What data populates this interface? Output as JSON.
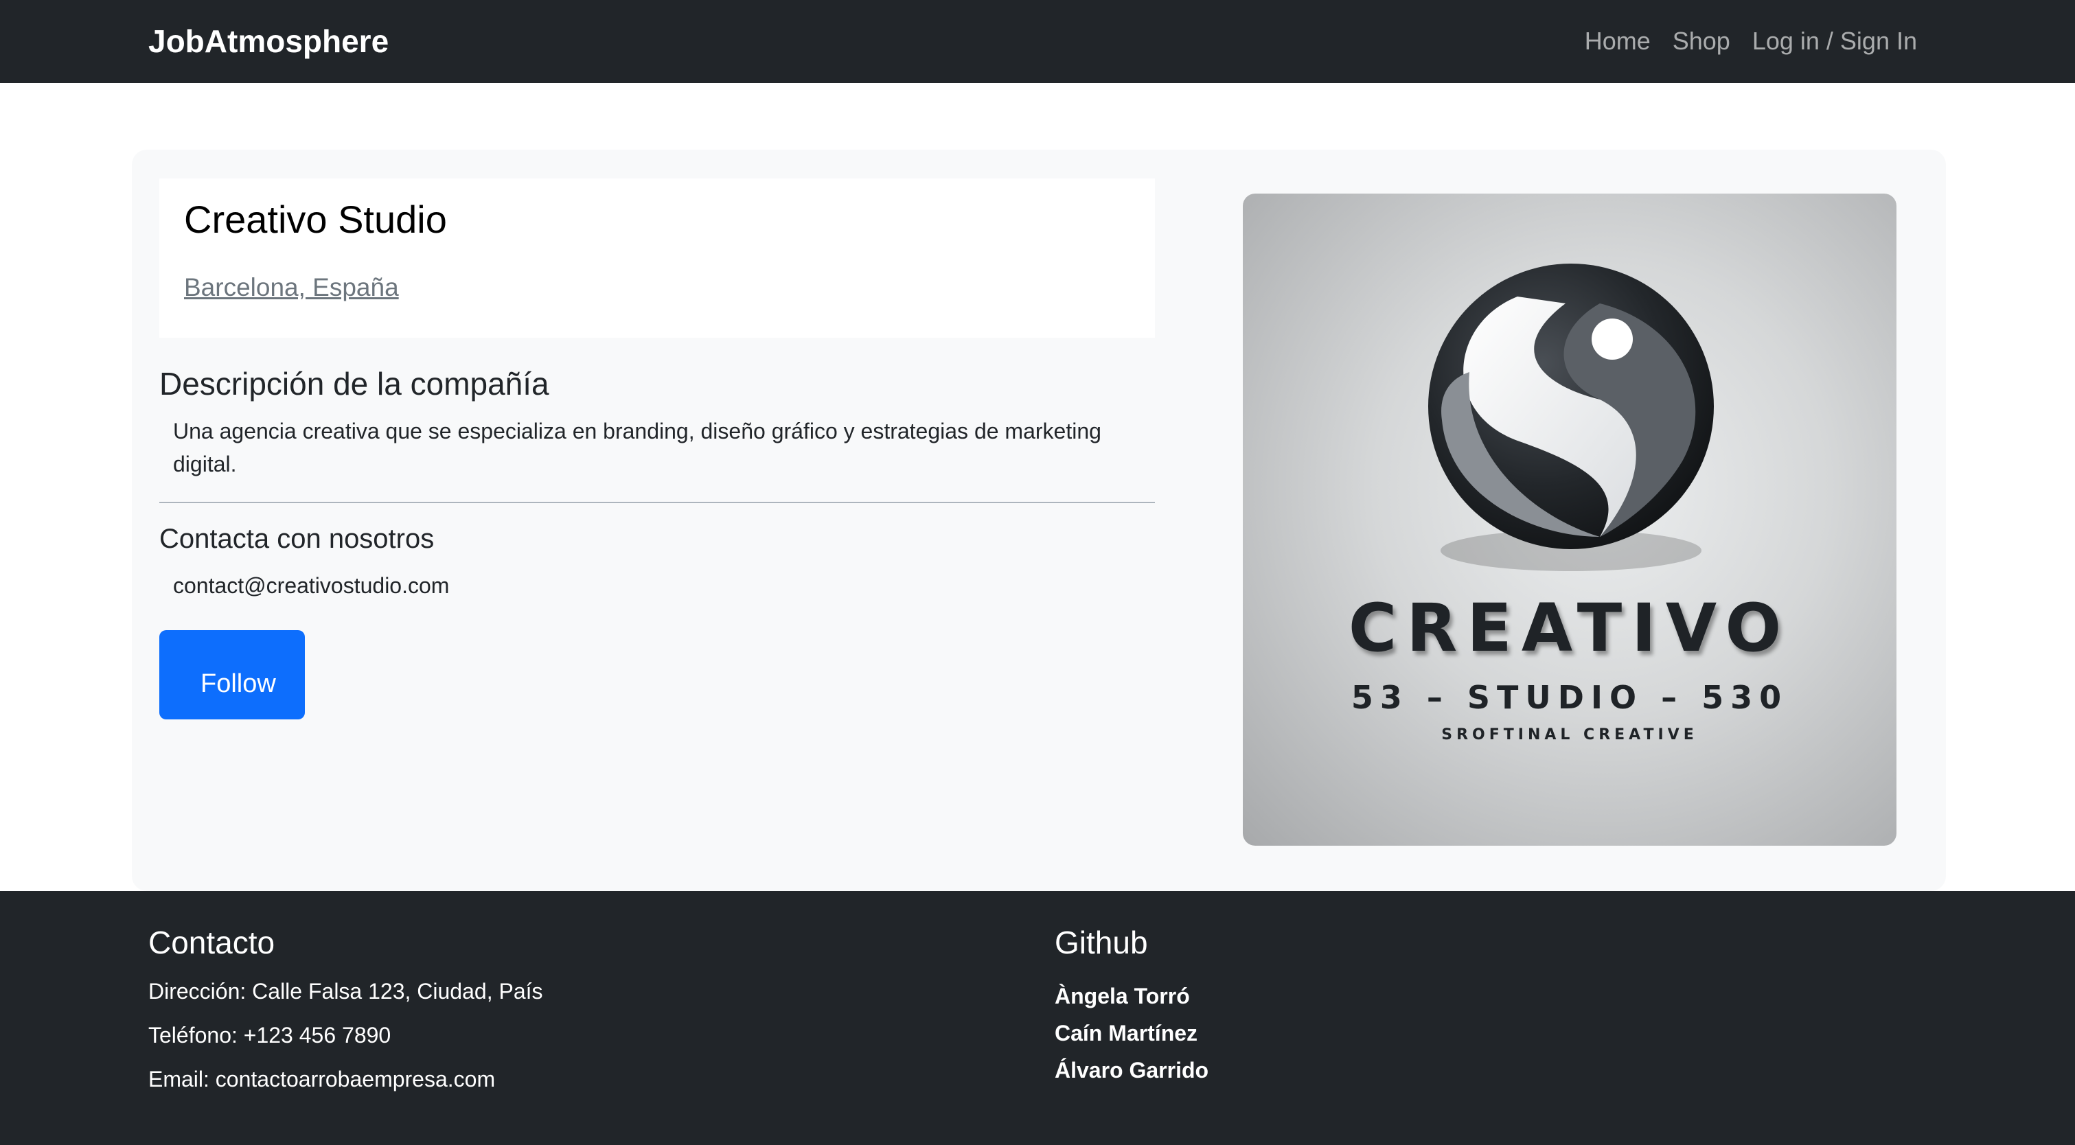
{
  "navbar": {
    "brand": "JobAtmosphere",
    "links": [
      "Home",
      "Shop",
      "Log in / Sign In"
    ]
  },
  "company": {
    "name": "Creativo Studio",
    "location": "Barcelona, España",
    "description_heading": "Descripción de la compañía",
    "description": "Una agencia creativa que se especializa en branding, diseño gráfico y estrategias de marketing digital.",
    "contact_heading": "Contacta con nosotros",
    "email": "contact@creativostudio.com",
    "follow_label": "Follow",
    "accent_color": "#0d6efd",
    "logo": {
      "icon": "swirl-logo-icon",
      "word_main": "CREATIVO",
      "word_sub": "53 – STUDIO – 530",
      "tagline": "SROFTINAL CREATIVE"
    }
  },
  "footer": {
    "contact_heading": "Contacto",
    "address": "Dirección: Calle Falsa 123, Ciudad, País",
    "phone": "Teléfono: +123 456 7890",
    "email": "Email: contactoarrobaempresa.com",
    "github_heading": "Github",
    "github_users": [
      "Àngela Torró",
      "Caín Martínez",
      "Álvaro Garrido"
    ]
  },
  "colors": {
    "navbar_bg": "#212529",
    "card_bg": "#f8f9fa",
    "footer_bg": "#212529",
    "link_muted": "#6c757d"
  }
}
